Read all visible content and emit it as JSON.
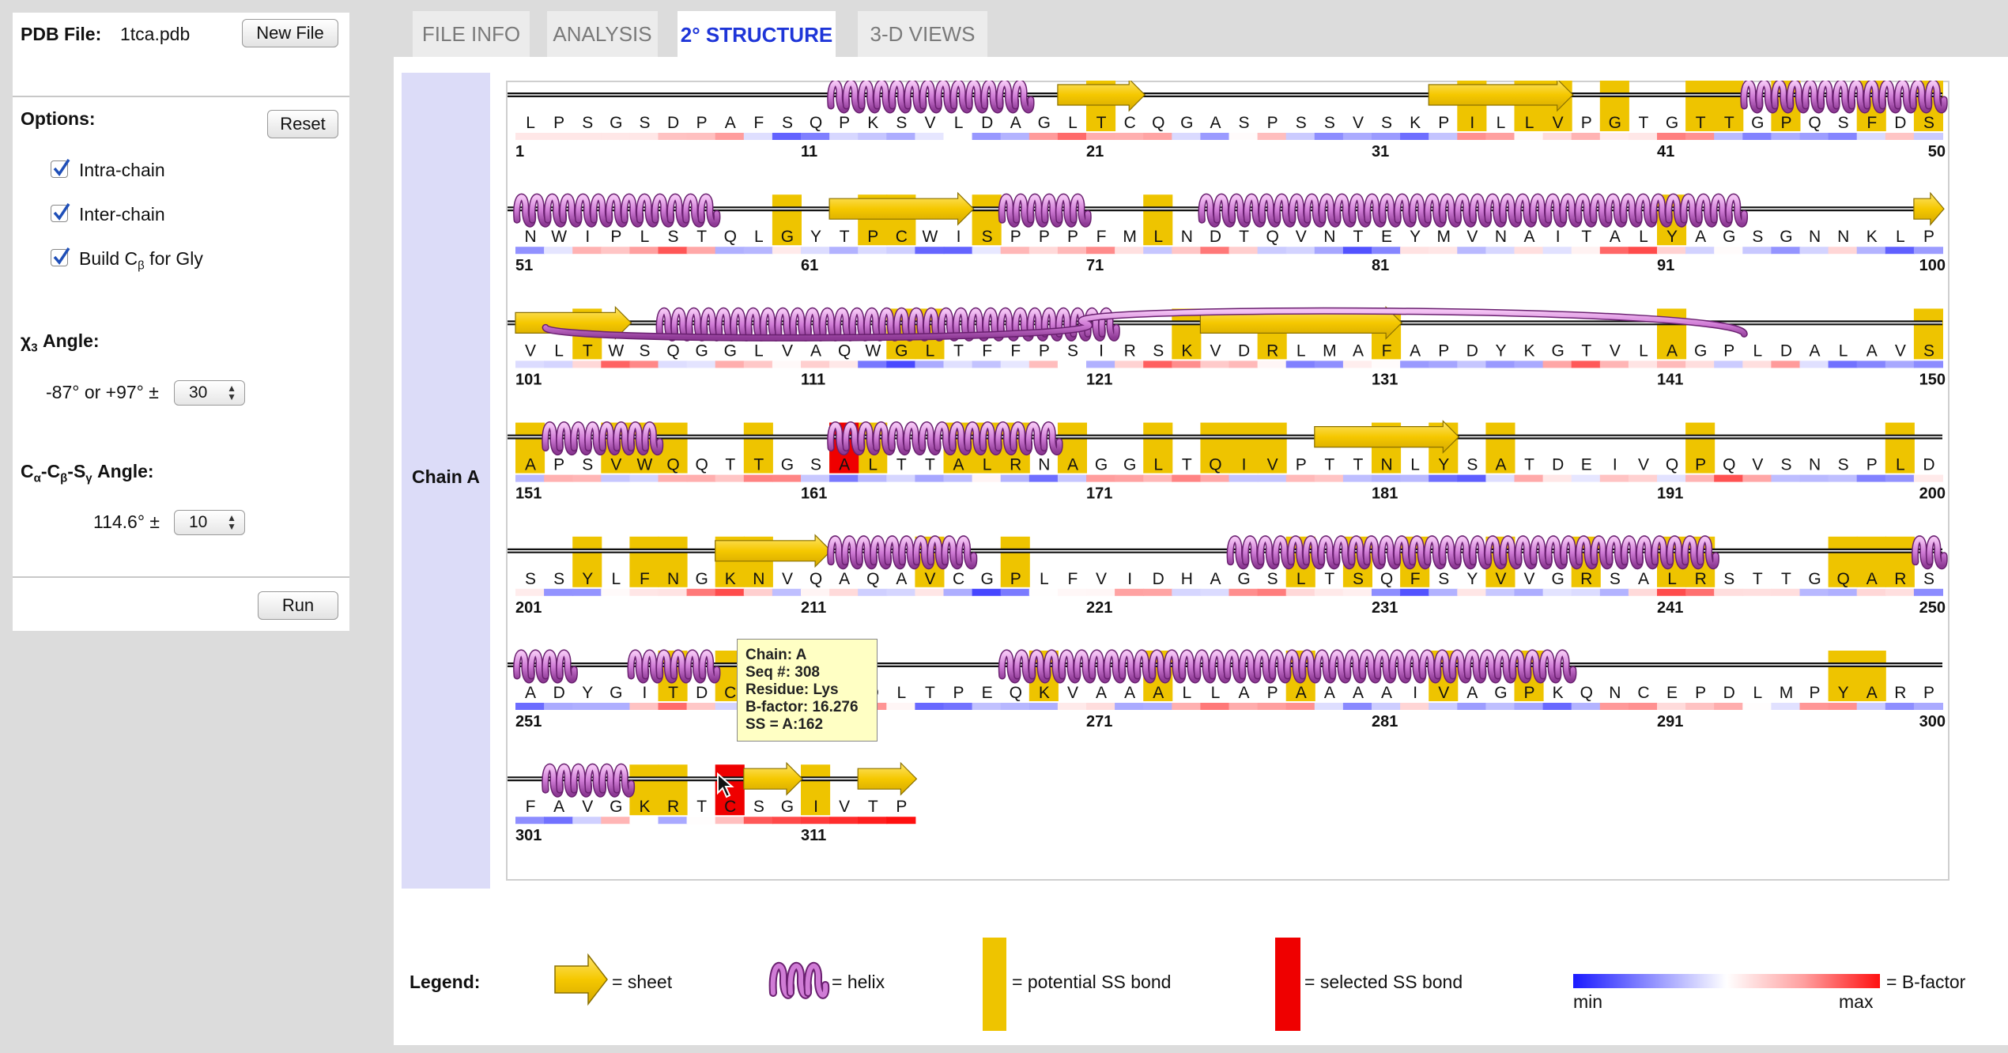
{
  "sidebar": {
    "pdb_label": "PDB File:",
    "pdb_filename": "1tca.pdb",
    "new_file_label": "New File",
    "options_label": "Options:",
    "reset_label": "Reset",
    "checkboxes": [
      {
        "label": "Intra-chain",
        "checked": true
      },
      {
        "label": "Inter-chain",
        "checked": true
      },
      {
        "label_main": "Build C",
        "label_sub": "β",
        "label_tail": " for Gly",
        "checked": true
      }
    ],
    "chi3": {
      "label_main": "χ",
      "label_sub": "3",
      "label_tail": " Angle:",
      "prefix": "-87° or +97° ±",
      "value": "30"
    },
    "cacbsg": {
      "label": "Cα-Cβ-Sγ Angle:",
      "l1": "C",
      "s1": "α",
      "l2": "-C",
      "s2": "β",
      "l3": "-S",
      "s3": "γ",
      "l4": " Angle:",
      "prefix": "114.6° ±",
      "value": "10"
    },
    "run_label": "Run"
  },
  "tabs": [
    {
      "label": "FILE INFO",
      "active": false
    },
    {
      "label": "ANALYSIS",
      "active": false
    },
    {
      "label": "2° STRUCTURE",
      "active": true
    },
    {
      "label": "3-D VIEWS",
      "active": false
    }
  ],
  "chain_label": "Chain A",
  "sequence": "LPSGSDPAFSQPKSVLDAGLTCQGASPSSVSKPILLVPGTGTTGPQSFDSNWIPLSTQLGYTPCWISPPPFMLNDTQVNTEYMVNAITALYAGSGNNKLPVLTWSQGGLVAQWGLTFFPSIRSKVDRLMAFAPDYKGTVLAGPLDALAVSAPSVWQQTTGSALTTALRNAGGLTQIVPTTNLYSATDEIVQPQVSNSPLDSSYLFNGKNVQAQAVCGPLFVIDHAGSLTSQFSYVVGRSALRSTTGQARSADYGITDCKSDNDLTPEQKVAAALLAPAAAAIVAGPKQNCEPDLMPYARPFAVGKRTCSGIVTP",
  "sequence_start": 1,
  "tick_labels": [
    "1",
    "11",
    "21",
    "31",
    "41",
    "50",
    "51",
    "61",
    "71",
    "81",
    "91",
    "100",
    "101",
    "111",
    "121",
    "131",
    "141",
    "150",
    "151",
    "161",
    "171",
    "181",
    "191",
    "200",
    "201",
    "211",
    "221",
    "231",
    "241",
    "250",
    "251",
    "261",
    "271",
    "281",
    "291",
    "300",
    "301",
    "311"
  ],
  "ss_elements": [
    {
      "type": "helix",
      "start": 12,
      "end": 18
    },
    {
      "type": "sheet",
      "start": 20,
      "end": 22
    },
    {
      "type": "sheet",
      "start": 33,
      "end": 37
    },
    {
      "type": "helix",
      "start": 44,
      "end": 50
    },
    {
      "type": "helix",
      "start": 51,
      "end": 57
    },
    {
      "type": "sheet",
      "start": 62,
      "end": 66
    },
    {
      "type": "helix",
      "start": 68,
      "end": 70
    },
    {
      "type": "helix",
      "start": 75,
      "end": 93
    },
    {
      "type": "sheet",
      "start": 100,
      "end": 100
    },
    {
      "type": "sheet",
      "start": 101,
      "end": 104
    },
    {
      "type": "helix",
      "start": 106,
      "end": 118
    },
    {
      "type": "helix",
      "start": 119,
      "end": 121
    },
    {
      "type": "sheet",
      "start": 125,
      "end": 131
    },
    {
      "type": "helix",
      "start": 144,
      "end": 151
    },
    {
      "type": "helix",
      "start": 152,
      "end": 155
    },
    {
      "type": "helix",
      "start": 162,
      "end": 169
    },
    {
      "type": "sheet",
      "start": 179,
      "end": 183
    },
    {
      "type": "sheet",
      "start": 208,
      "end": 211
    },
    {
      "type": "helix",
      "start": 212,
      "end": 216
    },
    {
      "type": "helix",
      "start": 226,
      "end": 242
    },
    {
      "type": "helix",
      "start": 250,
      "end": 250
    },
    {
      "type": "helix",
      "start": 251,
      "end": 252
    },
    {
      "type": "helix",
      "start": 255,
      "end": 257
    },
    {
      "type": "helix",
      "start": 268,
      "end": 287
    },
    {
      "type": "helix",
      "start": 302,
      "end": 304
    },
    {
      "type": "sheet",
      "start": 309,
      "end": 310
    },
    {
      "type": "sheet",
      "start": 313,
      "end": 314
    }
  ],
  "potential_ss": [
    21,
    34,
    36,
    37,
    39,
    42,
    43,
    45,
    48,
    50,
    60,
    63,
    64,
    67,
    73,
    91,
    103,
    114,
    115,
    124,
    127,
    131,
    141,
    150,
    151,
    154,
    155,
    156,
    159,
    162,
    163,
    166,
    167,
    168,
    170,
    173,
    175,
    176,
    177,
    181,
    183,
    185,
    192,
    199,
    203,
    205,
    206,
    208,
    209,
    215,
    218,
    228,
    230,
    232,
    235,
    238,
    241,
    242,
    247,
    248,
    249,
    256,
    258,
    269,
    273,
    278,
    283,
    286,
    297,
    298,
    305,
    306,
    311
  ],
  "selected_ss": [
    162,
    308
  ],
  "bfactor_min_label": "min",
  "bfactor_max_label": "max",
  "tooltip": {
    "chain": "Chain: A",
    "seq": "Seq #: 308",
    "residue": "Residue: Lys",
    "bfactor": "B-factor: 16.276",
    "ss": "SS = A:162"
  },
  "legend": {
    "title": "Legend:",
    "sheet": "= sheet",
    "helix": "= helix",
    "potential": "= potential SS bond",
    "selected": "= selected SS bond",
    "bfactor": "= B-factor",
    "min": "min",
    "max": "max"
  },
  "colors": {
    "sheet": "#f5c800",
    "potential": "#eec400",
    "selected": "#ef0000",
    "helix": "#d07cd6",
    "bfactor_low": "#1a1aff",
    "bfactor_high": "#ff1010"
  }
}
